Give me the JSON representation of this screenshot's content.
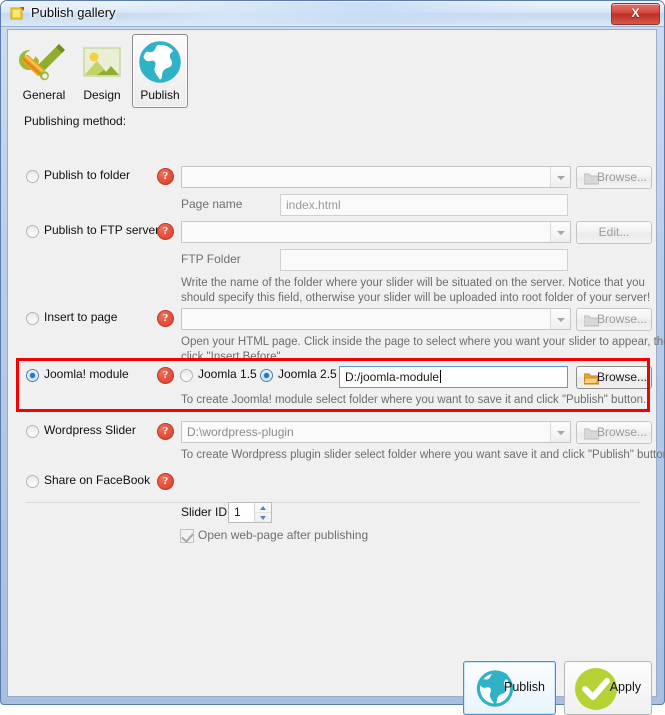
{
  "window": {
    "title": "Publish gallery",
    "app_icon": "gallery-icon",
    "close_label": "X"
  },
  "tabs": [
    {
      "id": "general",
      "label": "General",
      "icon": "wrench-screwdriver-icon",
      "selected": false
    },
    {
      "id": "design",
      "label": "Design",
      "icon": "picture-icon",
      "selected": false
    },
    {
      "id": "publish",
      "label": "Publish",
      "icon": "globe-icon",
      "selected": true
    }
  ],
  "content": {
    "section_label": "Publishing method:",
    "publish_to_folder": {
      "label": "Publish to folder",
      "selected": false,
      "help": "?",
      "path_value": "",
      "browse_label": "Browse...",
      "browse_enabled": false,
      "page_name_label": "Page name",
      "page_name_value": "index.html"
    },
    "publish_to_ftp": {
      "label": "Publish to FTP server",
      "selected": false,
      "help": "?",
      "server_value": "",
      "edit_label": "Edit...",
      "edit_enabled": false,
      "ftp_folder_label": "FTP Folder",
      "ftp_folder_value": "",
      "hint_line1": "Write the name of the folder where your slider will be situated on the server. Notice that you",
      "hint_line2": "should specify this field, otherwise your slider will be uploaded into root folder of your server!"
    },
    "insert_to_page": {
      "label": "Insert to page",
      "selected": false,
      "help": "?",
      "path_value": "",
      "browse_label": "Browse...",
      "browse_enabled": false,
      "hint_line1": "Open your HTML page. Click inside the page to select where you want your slider to appear, then",
      "hint_line2": "click \"Insert Before\"."
    },
    "joomla_module": {
      "label": "Joomla! module",
      "selected": true,
      "help": "?",
      "version_options": [
        {
          "label": "Joomla 1.5",
          "selected": false
        },
        {
          "label": "Joomla 2.5",
          "selected": true
        }
      ],
      "path_value": "D:/joomla-module",
      "browse_label": "Browse...",
      "browse_enabled": true,
      "hint": "To create Joomla! module select folder where you want to save it and click \"Publish\" button.",
      "highlighted": true
    },
    "wordpress_slider": {
      "label": "Wordpress Slider",
      "selected": false,
      "help": "?",
      "path_value": "D:\\wordpress-plugin",
      "browse_label": "Browse...",
      "browse_enabled": false,
      "hint": "To create Wordpress plugin slider select folder where you want save it and click \"Publish\" button"
    },
    "share_facebook": {
      "label": "Share on FaceBook",
      "selected": false,
      "help": "?"
    },
    "slider_id": {
      "label": "Slider ID",
      "value": "1"
    },
    "open_webpage": {
      "label": "Open web-page after publishing",
      "checked": true,
      "enabled": false
    }
  },
  "actions": {
    "publish": {
      "label": "Publish",
      "icon": "globe-icon",
      "focused": true
    },
    "apply": {
      "label": "Apply",
      "icon": "green-check-icon",
      "focused": false
    }
  },
  "colors": {
    "accent_teal": "#2fb2c6",
    "accent_green": "#b5d334",
    "help_red": "#e2523c",
    "highlight_red": "#f50000",
    "radio_blue": "#1c78c8",
    "title_blue": "#c5d8ef"
  }
}
